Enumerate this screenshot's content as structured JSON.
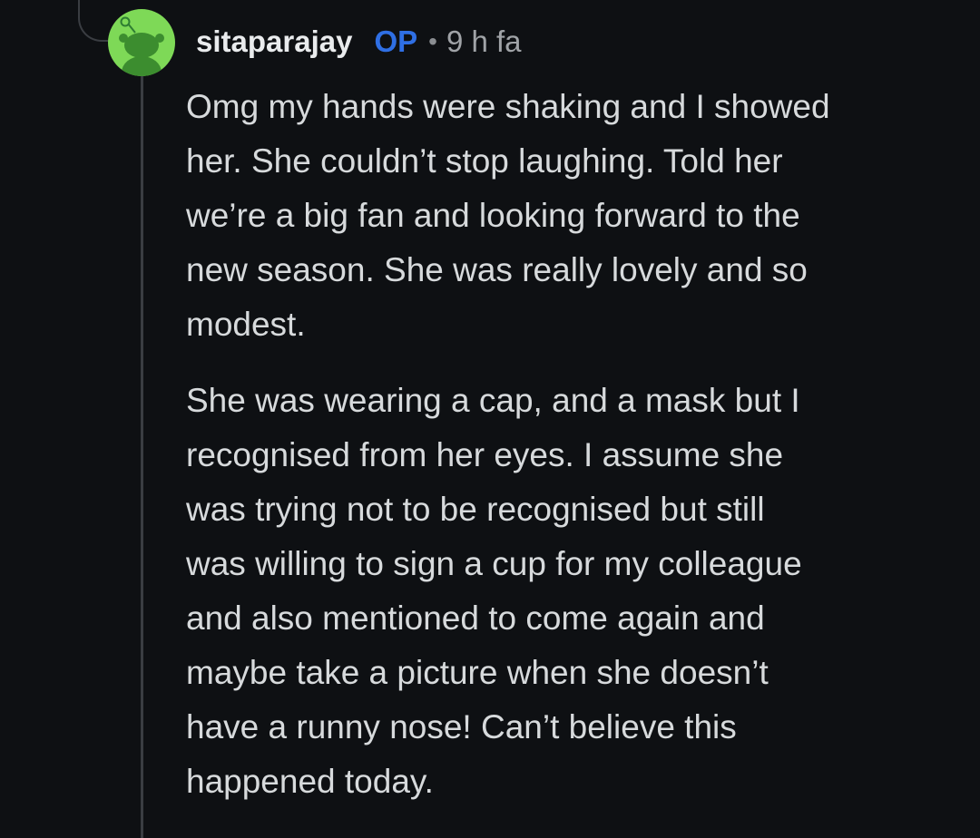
{
  "comment": {
    "author": "sitaparajay",
    "op_badge": "OP",
    "separator": "•",
    "timestamp": "9 h fa",
    "avatar_icon": "reddit-snoo-avatar-icon",
    "paragraphs": [
      {
        "lines": [
          "Omg my hands were shaking and I showed",
          "her. She couldn’t stop laughing. Told her",
          "we’re a big fan and looking forward to the",
          "new season. She was really lovely and so",
          "modest."
        ]
      },
      {
        "lines": [
          "She was wearing a cap, and a mask but I",
          "recognised from her eyes. I assume she",
          "was trying not to be recognised but still",
          "was willing to sign a cup for my colleague",
          "and also mentioned to come again and",
          "maybe take a picture when she doesn’t",
          "have a runny nose! Can’t believe this",
          "happened today."
        ]
      }
    ]
  },
  "colors": {
    "background": "#0e1013",
    "text": "#d7dadc",
    "op_badge": "#2f6fe4",
    "avatar_bg": "#7ed957",
    "thread_line": "#3a3d42"
  }
}
